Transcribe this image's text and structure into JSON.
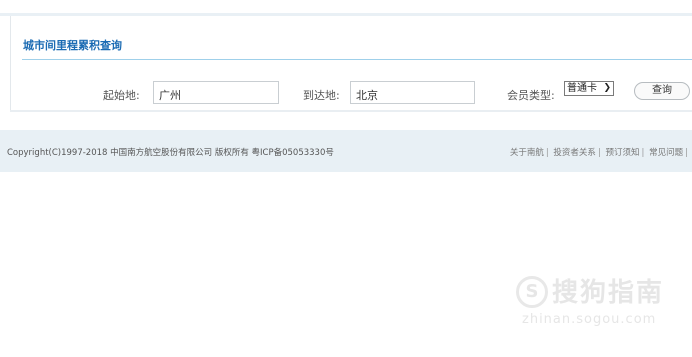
{
  "panel": {
    "title": "城市间里程累积查询"
  },
  "form": {
    "origin_label": "起始地:",
    "origin_value": "广州",
    "destination_label": "到达地:",
    "destination_value": "北京",
    "member_type_label": "会员类型:",
    "member_type_selected": "普通卡",
    "query_button": "查询"
  },
  "footer": {
    "copyright": "Copyright(C)1997-2018 中国南方航空股份有限公司 版权所有 粤ICP备05053330号",
    "links": [
      "关于南航",
      "投资者关系",
      "预订须知",
      "常见问题"
    ]
  },
  "watermark": {
    "text": "搜狗指南",
    "url": "zhinan.sogou.com",
    "icon": "sogou-logo"
  },
  "colors": {
    "title": "#1b6bb3",
    "rule": "#9fd0ea",
    "footer_bg": "#e8f0f5"
  }
}
